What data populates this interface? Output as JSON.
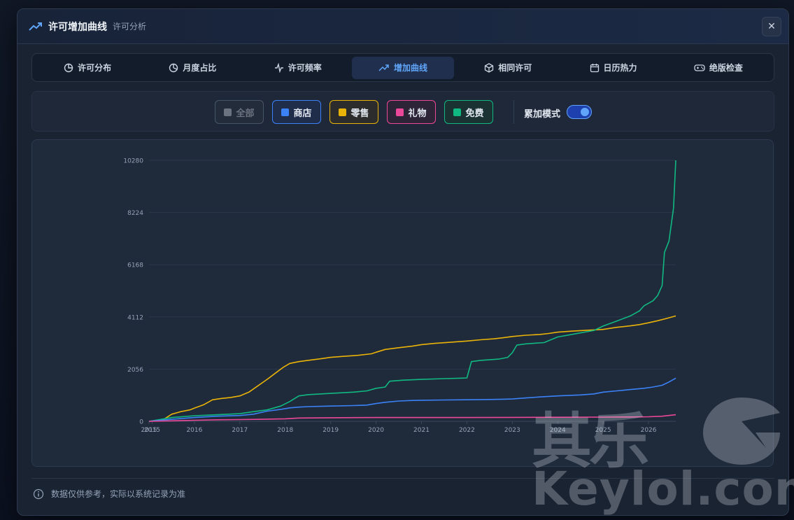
{
  "header": {
    "title": "许可增加曲线",
    "subtitle": "许可分析",
    "close": "✕"
  },
  "tabs": [
    {
      "label": "许可分布",
      "icon": "pie-icon"
    },
    {
      "label": "月度占比",
      "icon": "pie-slice-icon"
    },
    {
      "label": "许可频率",
      "icon": "activity-icon"
    },
    {
      "label": "增加曲线",
      "icon": "trend-up-icon",
      "active": true
    },
    {
      "label": "相同许可",
      "icon": "box-icon"
    },
    {
      "label": "日历热力",
      "icon": "calendar-icon"
    },
    {
      "label": "绝版检查",
      "icon": "gamepad-icon"
    }
  ],
  "filters": [
    {
      "label": "全部",
      "color": "#6b7280",
      "active": false
    },
    {
      "label": "商店",
      "color": "#3b82f6",
      "active": true
    },
    {
      "label": "零售",
      "color": "#eab308",
      "active": true
    },
    {
      "label": "礼物",
      "color": "#ec4899",
      "active": true
    },
    {
      "label": "免费",
      "color": "#10b981",
      "active": true
    }
  ],
  "toggle": {
    "label": "累加模式",
    "on": true
  },
  "footer": {
    "note": "数据仅供参考，实际以系统记录为准"
  },
  "watermark": {
    "cn": "其乐",
    "en": "Keylol.com"
  },
  "chart_data": {
    "type": "line",
    "title": "",
    "xlabel": "",
    "ylabel": "",
    "ylim": [
      0,
      10280
    ],
    "yticks": [
      0,
      2056,
      4112,
      6168,
      8224,
      10280
    ],
    "xlim": [
      2015.0,
      2026.6
    ],
    "xticks": [
      {
        "value": 2015.0,
        "label": "2015"
      },
      {
        "value": 2015.07,
        "label": "2015"
      },
      {
        "value": 2016,
        "label": "2016"
      },
      {
        "value": 2017,
        "label": "2017"
      },
      {
        "value": 2018,
        "label": "2018"
      },
      {
        "value": 2019,
        "label": "2019"
      },
      {
        "value": 2020,
        "label": "2020"
      },
      {
        "value": 2021,
        "label": "2021"
      },
      {
        "value": 2022,
        "label": "2022"
      },
      {
        "value": 2023,
        "label": "2023"
      },
      {
        "value": 2024,
        "label": "2024"
      },
      {
        "value": 2025,
        "label": "2025"
      },
      {
        "value": 2026,
        "label": "2026"
      }
    ],
    "grid": true,
    "series": [
      {
        "name": "零售",
        "color": "#eab308",
        "x": [
          2015.0,
          2015.3,
          2015.5,
          2015.7,
          2015.9,
          2016.0,
          2016.2,
          2016.4,
          2016.6,
          2016.8,
          2017.0,
          2017.2,
          2017.4,
          2017.6,
          2017.8,
          2017.95,
          2018.1,
          2018.3,
          2018.5,
          2018.8,
          2019.0,
          2019.3,
          2019.6,
          2019.9,
          2020.0,
          2020.2,
          2020.5,
          2020.8,
          2021.0,
          2021.3,
          2021.6,
          2022.0,
          2022.3,
          2022.6,
          2022.8,
          2023.0,
          2023.3,
          2023.6,
          2023.8,
          2024.0,
          2024.3,
          2024.6,
          2025.0,
          2025.3,
          2025.6,
          2025.8,
          2026.0,
          2026.2,
          2026.4,
          2026.6
        ],
        "values": [
          0,
          50,
          280,
          380,
          450,
          520,
          650,
          850,
          900,
          940,
          1000,
          1150,
          1400,
          1650,
          1920,
          2120,
          2280,
          2350,
          2400,
          2470,
          2520,
          2560,
          2600,
          2660,
          2720,
          2830,
          2900,
          2960,
          3020,
          3070,
          3110,
          3160,
          3210,
          3250,
          3290,
          3340,
          3390,
          3420,
          3460,
          3510,
          3550,
          3580,
          3620,
          3700,
          3760,
          3810,
          3880,
          3960,
          4050,
          4150
        ]
      },
      {
        "name": "免费",
        "color": "#10b981",
        "x": [
          2015.0,
          2015.5,
          2016.0,
          2016.5,
          2017.0,
          2017.3,
          2017.6,
          2017.9,
          2018.1,
          2018.3,
          2018.5,
          2019.0,
          2019.5,
          2019.8,
          2020.0,
          2020.2,
          2020.3,
          2020.6,
          2021.0,
          2021.5,
          2021.9,
          2022.0,
          2022.1,
          2022.3,
          2022.7,
          2022.9,
          2023.0,
          2023.1,
          2023.3,
          2023.7,
          2023.9,
          2024.0,
          2024.4,
          2024.8,
          2025.0,
          2025.3,
          2025.6,
          2025.8,
          2025.9,
          2026.1,
          2026.2,
          2026.3,
          2026.35,
          2026.45,
          2026.55,
          2026.6
        ],
        "values": [
          0,
          150,
          220,
          260,
          300,
          380,
          450,
          600,
          780,
          1000,
          1050,
          1100,
          1150,
          1200,
          1300,
          1350,
          1580,
          1620,
          1650,
          1680,
          1700,
          1710,
          2350,
          2400,
          2450,
          2520,
          2700,
          3000,
          3050,
          3100,
          3250,
          3320,
          3450,
          3580,
          3750,
          3950,
          4150,
          4350,
          4550,
          4750,
          4950,
          5350,
          6650,
          7100,
          8400,
          10280
        ]
      },
      {
        "name": "商店",
        "color": "#3b82f6",
        "x": [
          2015.0,
          2015.5,
          2016.0,
          2016.5,
          2017.0,
          2017.3,
          2017.6,
          2017.9,
          2018.1,
          2018.3,
          2018.5,
          2019.0,
          2019.5,
          2019.8,
          2020.0,
          2020.2,
          2020.5,
          2020.8,
          2021.0,
          2021.5,
          2022.0,
          2022.5,
          2022.8,
          2023.0,
          2023.3,
          2023.6,
          2024.0,
          2024.5,
          2024.8,
          2025.0,
          2025.3,
          2025.6,
          2025.9,
          2026.1,
          2026.3,
          2026.45,
          2026.6
        ],
        "values": [
          0,
          80,
          150,
          200,
          230,
          280,
          400,
          470,
          530,
          560,
          580,
          600,
          620,
          640,
          700,
          750,
          800,
          820,
          830,
          840,
          850,
          860,
          870,
          880,
          920,
          960,
          1000,
          1040,
          1080,
          1150,
          1200,
          1250,
          1300,
          1350,
          1420,
          1550,
          1700
        ]
      },
      {
        "name": "礼物",
        "color": "#ec4899",
        "x": [
          2015.0,
          2015.5,
          2016.0,
          2016.5,
          2017.0,
          2017.5,
          2018.0,
          2018.3,
          2019.0,
          2020.0,
          2021.0,
          2022.0,
          2023.0,
          2024.0,
          2025.0,
          2025.6,
          2026.0,
          2026.3,
          2026.6
        ],
        "values": [
          0,
          20,
          40,
          60,
          70,
          80,
          100,
          130,
          140,
          150,
          150,
          150,
          155,
          160,
          165,
          170,
          180,
          200,
          260
        ]
      }
    ]
  }
}
